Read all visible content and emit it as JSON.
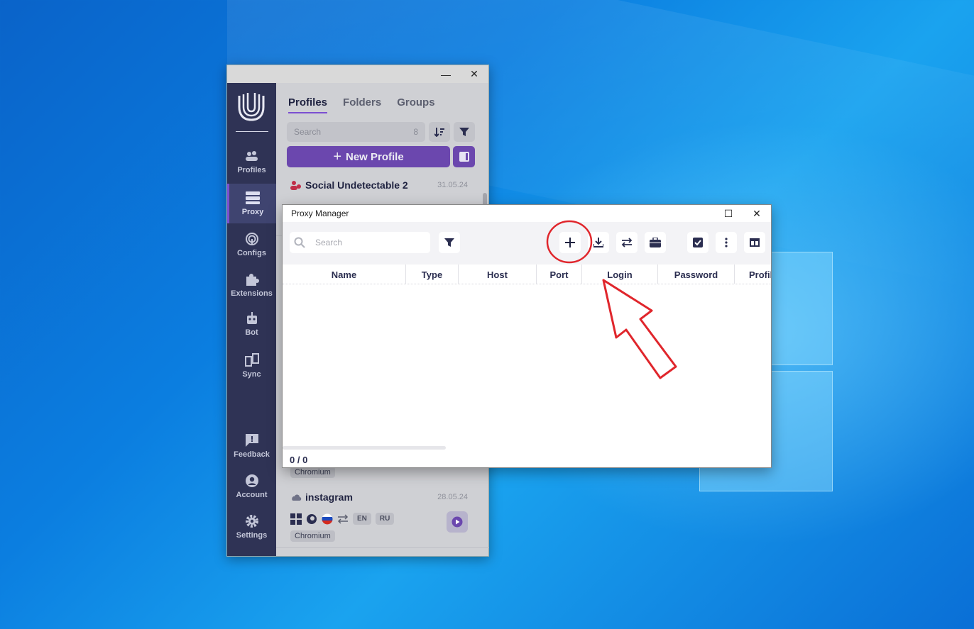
{
  "app": {
    "nav": [
      {
        "label": "Profiles",
        "icon": "users-icon"
      },
      {
        "label": "Proxy",
        "icon": "server-icon"
      },
      {
        "label": "Configs",
        "icon": "fingerprint-icon"
      },
      {
        "label": "Extensions",
        "icon": "puzzle-icon"
      },
      {
        "label": "Bot",
        "icon": "robot-icon"
      },
      {
        "label": "Sync",
        "icon": "sync-icon"
      },
      {
        "label": "Feedback",
        "icon": "feedback-icon"
      },
      {
        "label": "Account",
        "icon": "account-icon"
      },
      {
        "label": "Settings",
        "icon": "gear-icon"
      }
    ],
    "tabs": [
      "Profiles",
      "Folders",
      "Groups"
    ],
    "search_placeholder": "Search",
    "profile_count": "8",
    "new_profile_label": "New Profile",
    "profiles": [
      {
        "name": "Social Undetectable 2",
        "date": "31.05.24"
      },
      {
        "name": "instagram",
        "date": "28.05.24",
        "langs": [
          "EN",
          "RU"
        ],
        "browser": "Chromium"
      }
    ],
    "hidden_browser_chip": "Chromium"
  },
  "proxy_manager": {
    "title": "Proxy Manager",
    "search_placeholder": "Search",
    "columns": [
      "Name",
      "Type",
      "Host",
      "Port",
      "Login",
      "Password",
      "Profil"
    ],
    "footer": "0 / 0"
  },
  "colors": {
    "accent": "#6b47ae",
    "sidebar": "#2f3355",
    "annotation": "#e0262c"
  }
}
